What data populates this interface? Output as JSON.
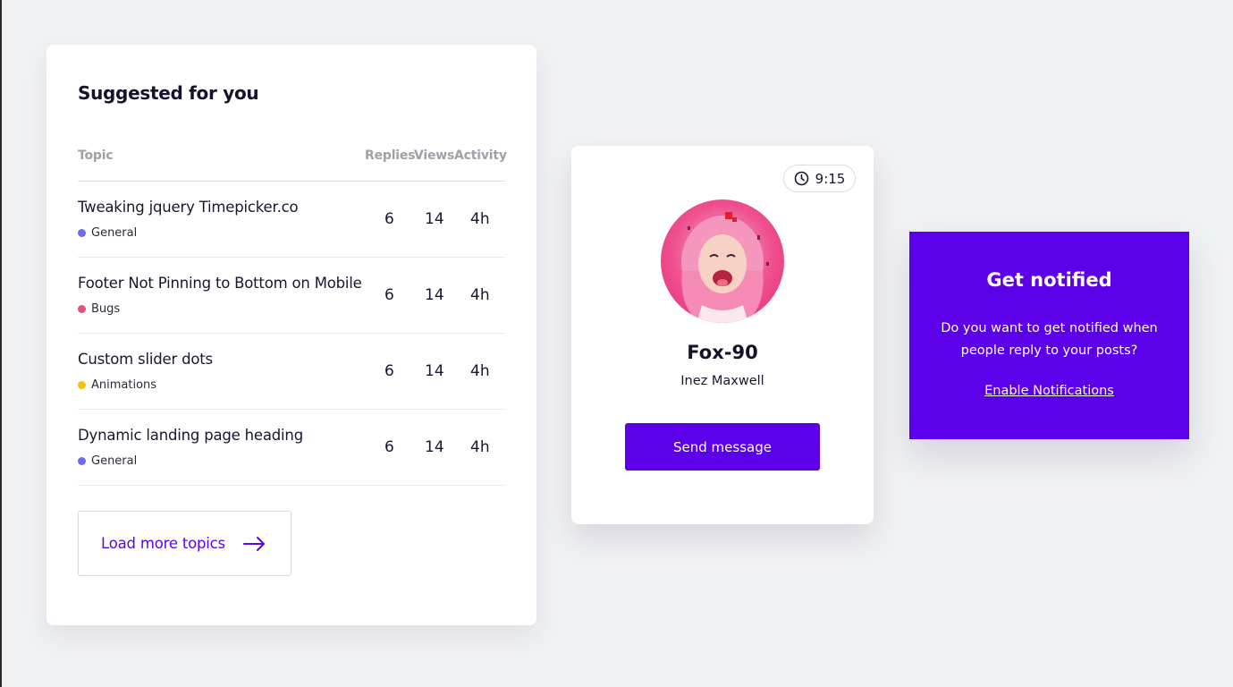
{
  "suggested": {
    "title": "Suggested for you",
    "columns": {
      "topic": "Topic",
      "replies": "Replies",
      "views": "Views",
      "activity": "Activity"
    },
    "rows": [
      {
        "title": "Tweaking jquery Timepicker.co",
        "category": "General",
        "category_color": "#6c6cf0",
        "replies": "6",
        "views": "14",
        "activity": "4h"
      },
      {
        "title": "Footer Not Pinning to Bottom on Mobile",
        "category": "Bugs",
        "category_color": "#ec4a83",
        "replies": "6",
        "views": "14",
        "activity": "4h"
      },
      {
        "title": "Custom slider dots",
        "category": "Animations",
        "category_color": "#f4c20d",
        "replies": "6",
        "views": "14",
        "activity": "4h"
      },
      {
        "title": "Dynamic landing page heading",
        "category": "General",
        "category_color": "#6c6cf0",
        "replies": "6",
        "views": "14",
        "activity": "4h"
      }
    ],
    "load_more_label": "Load more topics",
    "load_more_icon": "arrow-right-icon"
  },
  "profile": {
    "time": "9:15",
    "time_icon": "clock-icon",
    "handle": "Fox-90",
    "name": "Inez Maxwell",
    "send_label": "Send message"
  },
  "notify": {
    "title": "Get notified",
    "description": "Do you want to get notified when people reply to your posts?",
    "link_label": "Enable Notifications"
  },
  "colors": {
    "accent": "#5b00e8",
    "background": "#f0f1f3"
  }
}
